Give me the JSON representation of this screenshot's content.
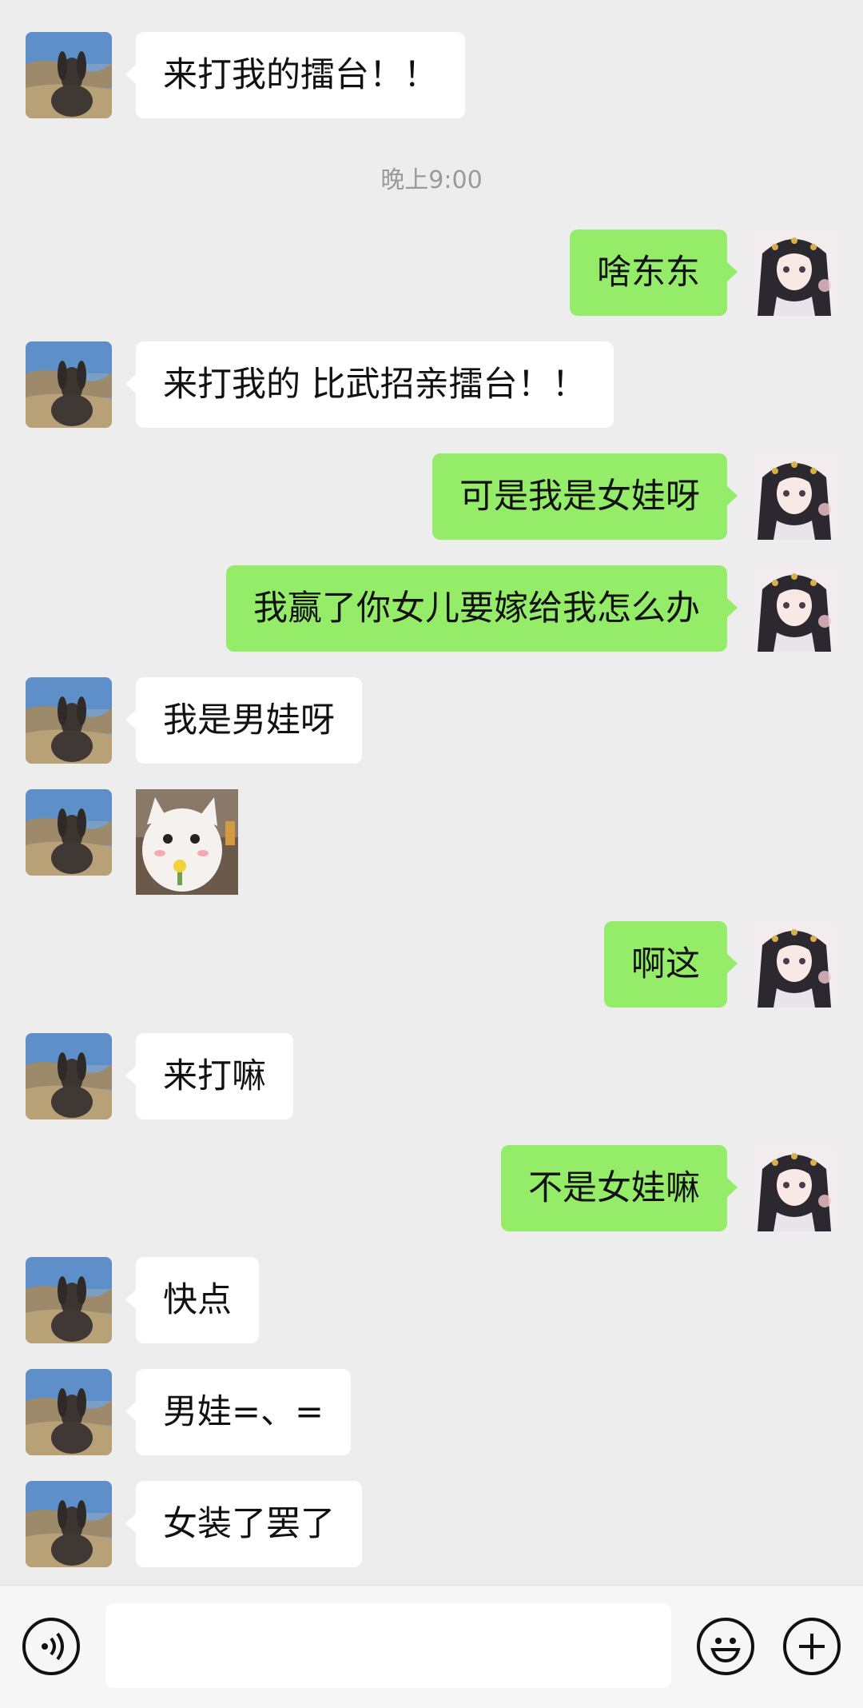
{
  "timestamp": "晚上9:00",
  "messages": [
    {
      "side": "in",
      "text": "来打我的擂台！！"
    },
    {
      "side": "out",
      "text": "啥东东"
    },
    {
      "side": "in",
      "text": "来打我的 比武招亲擂台！！"
    },
    {
      "side": "out",
      "text": "可是我是女娃呀"
    },
    {
      "side": "out",
      "text": "我赢了你女儿要嫁给我怎么办"
    },
    {
      "side": "in",
      "text": "我是男娃呀"
    },
    {
      "side": "in",
      "sticker": "cat-sticker"
    },
    {
      "side": "out",
      "text": "啊这"
    },
    {
      "side": "in",
      "text": "来打嘛"
    },
    {
      "side": "out",
      "text": "不是女娃嘛"
    },
    {
      "side": "in",
      "text": "快点"
    },
    {
      "side": "in",
      "text": "男娃=、="
    },
    {
      "side": "in",
      "text": "女装了罢了"
    }
  ],
  "input_bar": {
    "voice_icon": "voice-icon",
    "input_value": "",
    "emoji_icon": "emoji-icon",
    "plus_icon": "plus-icon"
  },
  "colors": {
    "background": "#ededed",
    "incoming_bubble": "#ffffff",
    "outgoing_bubble": "#95ec69",
    "timestamp": "#9a9a9a"
  }
}
